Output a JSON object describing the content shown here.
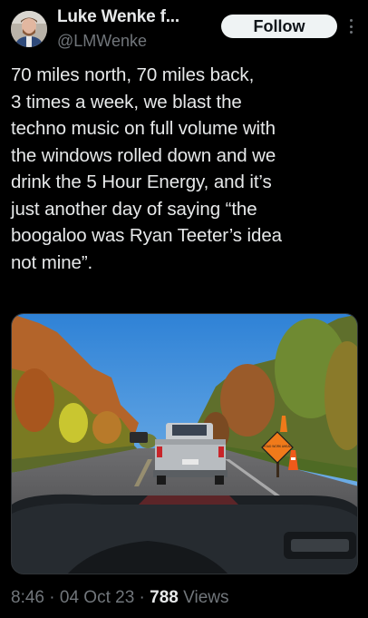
{
  "author": {
    "display_name": "Luke Wenke f...",
    "handle": "@LMWenke"
  },
  "follow_button": {
    "label": "Follow"
  },
  "tweet": {
    "text": "70 miles north, 70 miles back,\n3 times a week, we blast the\ntechno music on full volume with\nthe windows rolled down and we\ndrink the 5 Hour Energy, and it’s\njust another day of saying “the\nboogaloo was Ryan Teeter’s idea\nnot mine”."
  },
  "media": {
    "sign_text": "ROAD WORK AHEAD"
  },
  "meta": {
    "time": "8:46",
    "sep1": " · ",
    "date": "04 Oct 23",
    "sep2": " · ",
    "views_count": "788",
    "views_label": " Views"
  },
  "colors": {
    "background": "#000000",
    "text_primary": "#e7e9ea",
    "text_secondary": "#71767b",
    "follow_bg": "#eff3f4"
  }
}
